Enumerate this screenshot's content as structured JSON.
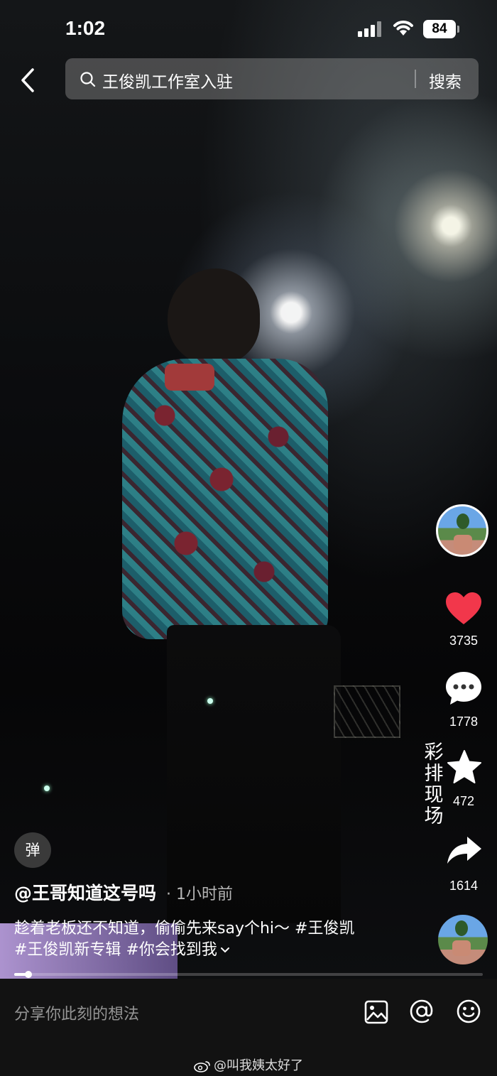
{
  "status_bar": {
    "time": "1:02",
    "battery": "84"
  },
  "search": {
    "query": "王俊凯工作室入驻",
    "button": "搜索"
  },
  "video": {
    "overlay_text": "彩排现场",
    "progress": 0.03
  },
  "actions": {
    "likes": "3735",
    "comments": "1778",
    "favorites": "472",
    "shares": "1614"
  },
  "post": {
    "danmu_label": "弹",
    "author": "@王哥知道这号吗",
    "time": "· 1小时前",
    "caption_line1": "趁着老板还不知道，偷偷先来say个hi～ ",
    "tag1": "#王俊凯",
    "tag2": "#王俊凯新专辑",
    "tag3": "#你会找到我"
  },
  "comment_bar": {
    "placeholder": "分享你此刻的想法",
    "watermark": "@叫我姨太好了"
  },
  "colors": {
    "heart": "#f2374b",
    "background": "#000000"
  }
}
